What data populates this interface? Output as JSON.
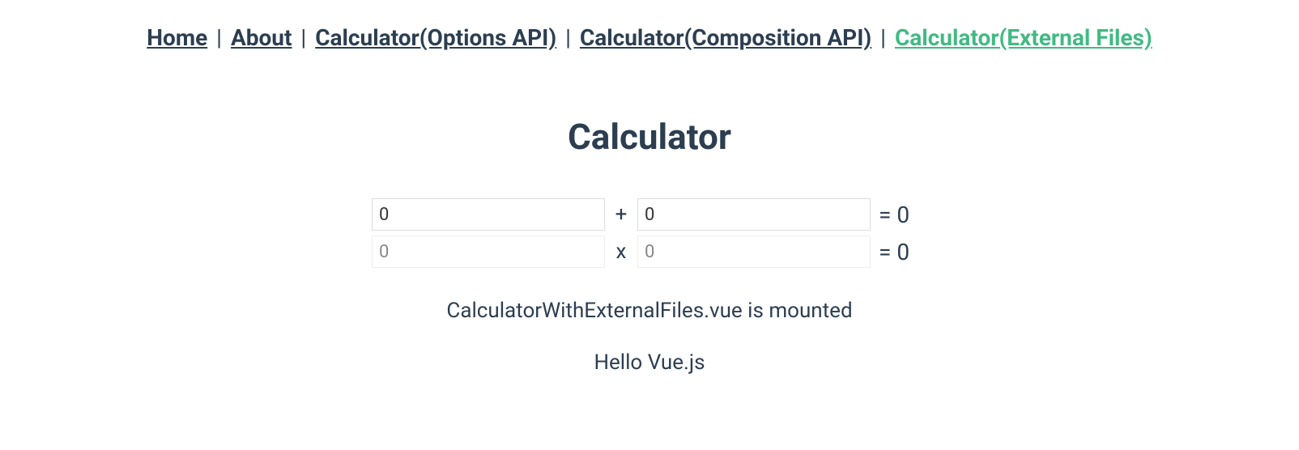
{
  "nav": {
    "home": "Home",
    "about": "About",
    "calc_options": "Calculator(Options API)",
    "calc_composition": "Calculator(Composition API)",
    "calc_external": "Calculator(External Files)",
    "separator": " | "
  },
  "title": "Calculator",
  "addition": {
    "a": "0",
    "b": "0",
    "operator": "+",
    "equals": " = ",
    "result": "0"
  },
  "multiplication": {
    "a": "0",
    "b": "0",
    "operator": "x",
    "equals": " = ",
    "result": "0"
  },
  "status": "CalculatorWithExternalFiles.vue is mounted",
  "greeting": "Hello Vue.js"
}
